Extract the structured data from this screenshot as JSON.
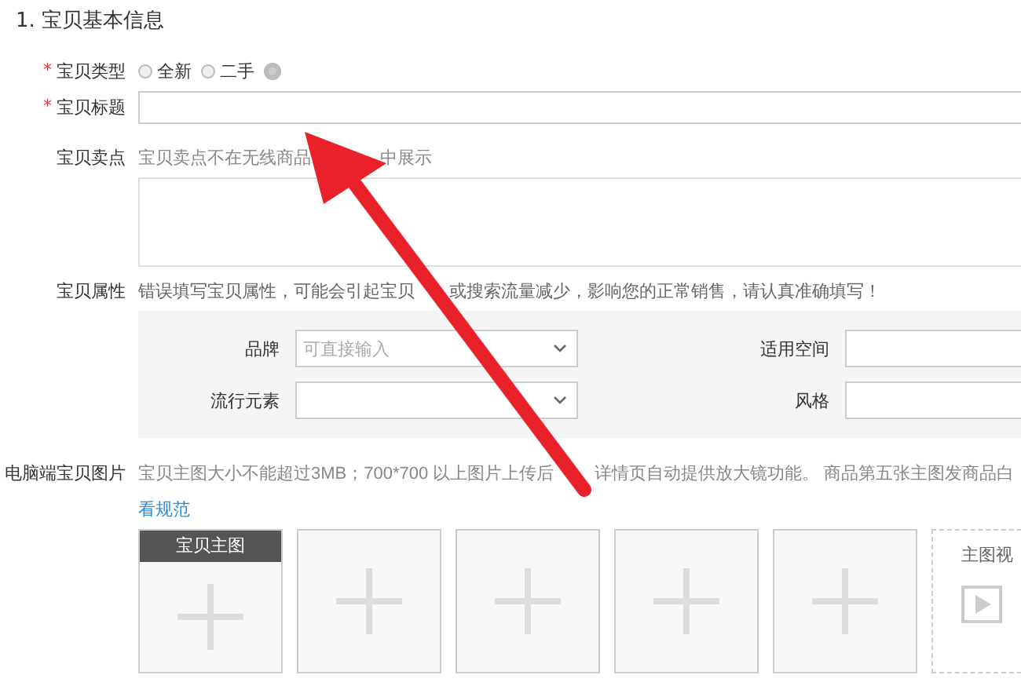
{
  "section_title": "1. 宝贝基本信息",
  "item_type": {
    "label": "宝贝类型",
    "required_mark": "*",
    "options": [
      {
        "label": "全新",
        "selected": false
      },
      {
        "label": "二手",
        "selected": false
      }
    ]
  },
  "item_title": {
    "label": "宝贝标题",
    "required_mark": "*"
  },
  "selling_point": {
    "label": "宝贝卖点",
    "hint": [
      "宝贝卖点不在无线商品",
      "中展示"
    ]
  },
  "attributes": {
    "label": "宝贝属性",
    "hint": [
      "错误填写宝贝属性，可能会引起宝贝",
      "或搜索流量减少，影响您的正常销售，请认真准确填写！"
    ],
    "fields": [
      {
        "label": "品牌",
        "kind": "select",
        "placeholder": "可直接输入"
      },
      {
        "label": "适用空间",
        "kind": "input"
      },
      {
        "label": "流行元素",
        "kind": "select"
      },
      {
        "label": "风格",
        "kind": "input"
      }
    ]
  },
  "pictures": {
    "label": "电脑端宝贝图片",
    "hint": [
      "宝贝主图大小不能超过3MB；700*700 以上图片上传后",
      "详情页自动提供放大镜功能。 商品第五张主图发商品白"
    ],
    "link": "看规范",
    "slots": [
      {
        "kind": "main",
        "caption": "宝贝主图"
      },
      {
        "kind": "image"
      },
      {
        "kind": "image"
      },
      {
        "kind": "image"
      },
      {
        "kind": "image"
      },
      {
        "kind": "video",
        "caption": "主图视"
      }
    ]
  }
}
